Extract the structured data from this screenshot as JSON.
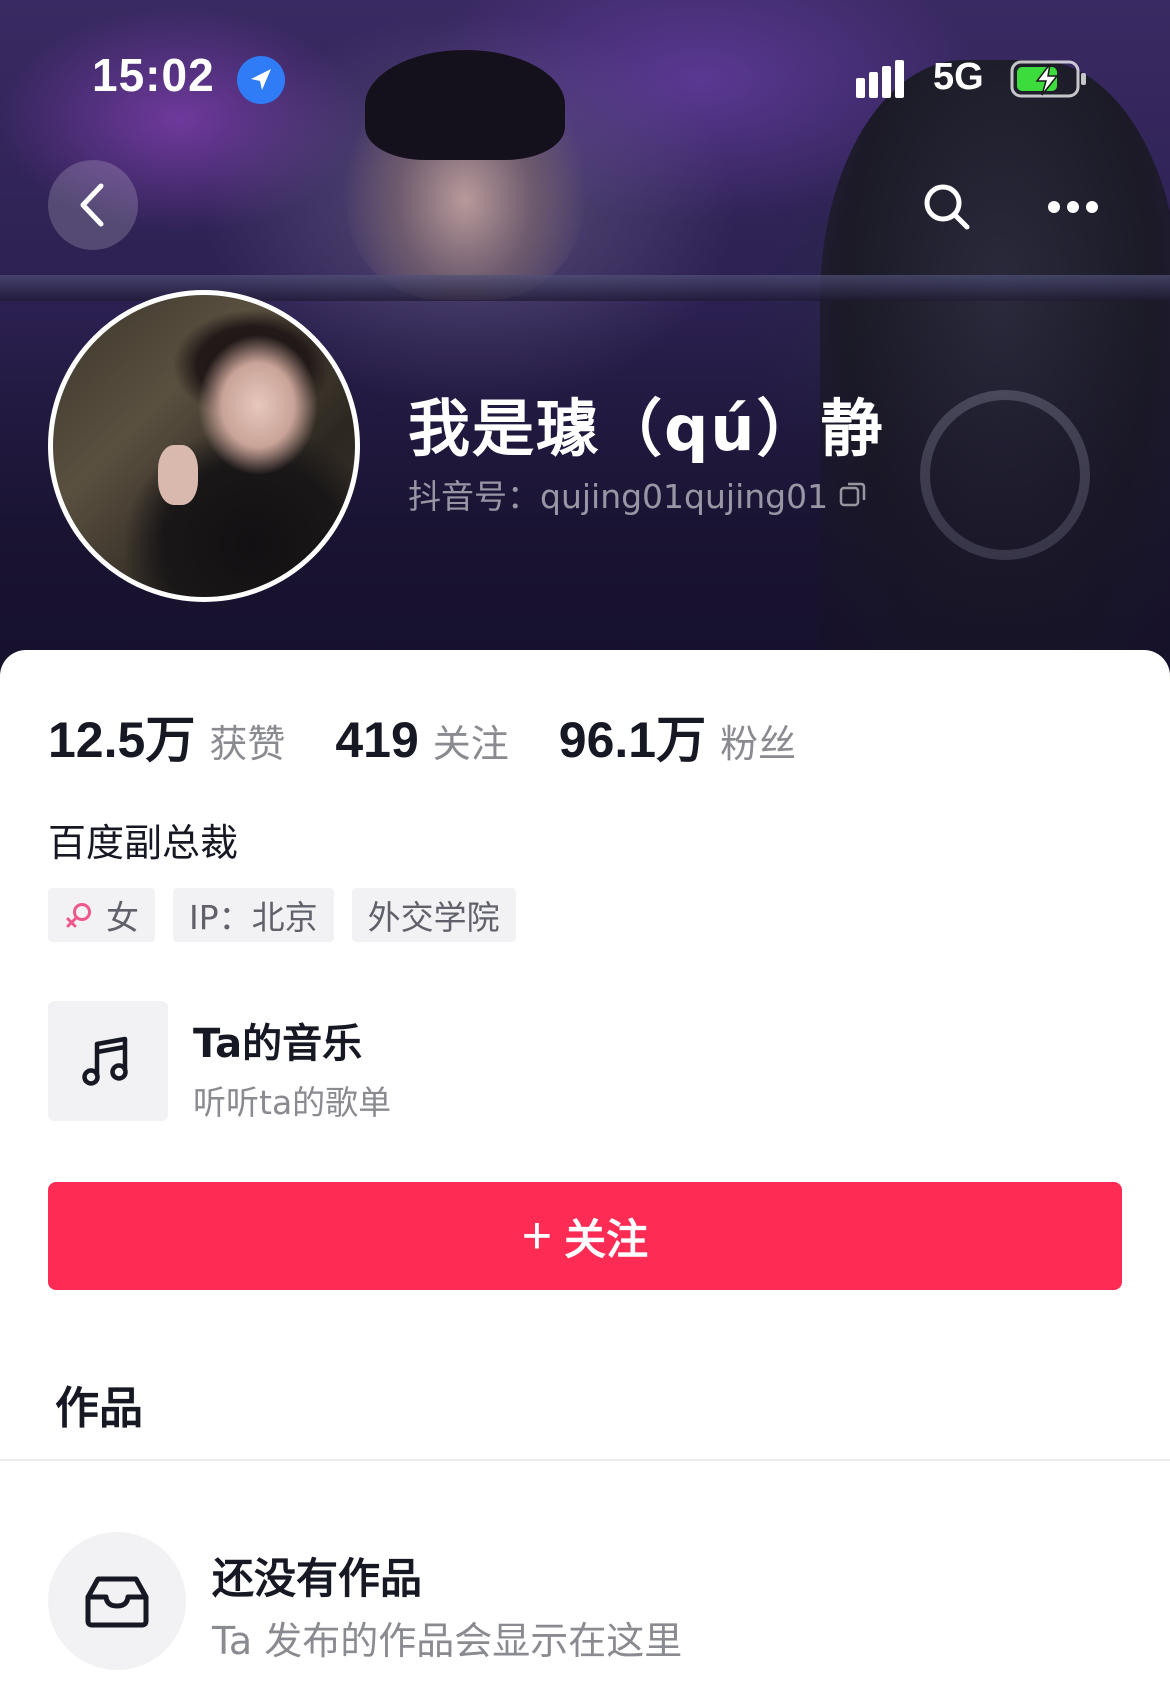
{
  "status_bar": {
    "time": "15:02",
    "network": "5G",
    "icons": [
      "location-arrow-icon",
      "signal-bars-icon",
      "battery-charging-icon"
    ]
  },
  "nav": {
    "icons": [
      "chevron-left-icon",
      "search-icon",
      "more-dots-icon"
    ]
  },
  "profile": {
    "display_name": "我是璩（qú）静",
    "douyin_id": "抖音号：qujing01qujing01",
    "bio": "百度副总裁",
    "stats": [
      {
        "value": "12.5万",
        "label": "获赞"
      },
      {
        "value": "419",
        "label": "关注"
      },
      {
        "value": "96.1万",
        "label": "粉丝"
      }
    ],
    "tags": {
      "gender": "女",
      "ip": "IP：北京",
      "school": "外交学院"
    }
  },
  "music": {
    "title": "Ta的音乐",
    "subtitle": "听听ta的歌单"
  },
  "follow_button": {
    "plus": "+",
    "label": "关注"
  },
  "tabs": {
    "works": "作品"
  },
  "empty_state": {
    "title": "还没有作品",
    "subtitle": "Ta 发布的作品会显示在这里"
  },
  "colors": {
    "accent": "#fe2c55",
    "gender_female": "#f0568e",
    "location_blue": "#2f7cf6",
    "battery_green": "#3ddc3d"
  }
}
